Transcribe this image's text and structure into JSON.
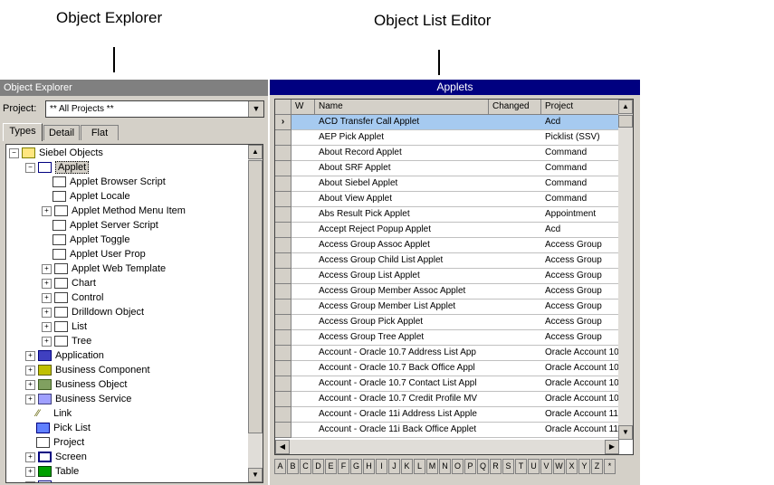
{
  "callouts": {
    "explorer": "Object Explorer",
    "list_editor": "Object List Editor"
  },
  "explorer": {
    "title": "Object Explorer",
    "project_label": "Project:",
    "project_value": "** All Projects **",
    "tabs": [
      "Types",
      "Detail",
      "Flat"
    ],
    "tree": [
      {
        "label": "Siebel Objects",
        "icon": "siebel-objects-icon",
        "cls": "folder-y",
        "indent": 0,
        "exp": "−"
      },
      {
        "label": "Applet",
        "icon": "applet-folder-icon",
        "cls": "folder-b",
        "indent": 1,
        "exp": "−",
        "selected": true
      },
      {
        "label": "Applet Browser Script",
        "icon": "folder-icon",
        "cls": "folder-w",
        "indent": 2,
        "exp": ""
      },
      {
        "label": "Applet Locale",
        "icon": "folder-icon",
        "cls": "folder-w",
        "indent": 2,
        "exp": ""
      },
      {
        "label": "Applet Method Menu Item",
        "icon": "folder-icon",
        "cls": "folder-w",
        "indent": 2,
        "exp": "+"
      },
      {
        "label": "Applet Server Script",
        "icon": "folder-icon",
        "cls": "folder-w",
        "indent": 2,
        "exp": ""
      },
      {
        "label": "Applet Toggle",
        "icon": "folder-icon",
        "cls": "folder-w",
        "indent": 2,
        "exp": ""
      },
      {
        "label": "Applet User Prop",
        "icon": "folder-icon",
        "cls": "folder-w",
        "indent": 2,
        "exp": ""
      },
      {
        "label": "Applet Web Template",
        "icon": "folder-icon",
        "cls": "folder-w",
        "indent": 2,
        "exp": "+"
      },
      {
        "label": "Chart",
        "icon": "folder-icon",
        "cls": "folder-w",
        "indent": 2,
        "exp": "+"
      },
      {
        "label": "Control",
        "icon": "folder-icon",
        "cls": "folder-w",
        "indent": 2,
        "exp": "+"
      },
      {
        "label": "Drilldown Object",
        "icon": "folder-icon",
        "cls": "folder-w",
        "indent": 2,
        "exp": "+"
      },
      {
        "label": "List",
        "icon": "folder-icon",
        "cls": "folder-w",
        "indent": 2,
        "exp": "+"
      },
      {
        "label": "Tree",
        "icon": "folder-icon",
        "cls": "folder-w",
        "indent": 2,
        "exp": "+"
      },
      {
        "label": "Application",
        "icon": "application-icon",
        "cls": "app",
        "indent": 1,
        "exp": "+"
      },
      {
        "label": "Business Component",
        "icon": "business-component-icon",
        "cls": "bc",
        "indent": 1,
        "exp": "+"
      },
      {
        "label": "Business Object",
        "icon": "business-object-icon",
        "cls": "bo",
        "indent": 1,
        "exp": "+"
      },
      {
        "label": "Business Service",
        "icon": "business-service-icon",
        "cls": "bs",
        "indent": 1,
        "exp": "+"
      },
      {
        "label": "Link",
        "icon": "link-icon",
        "cls": "link",
        "indent": 1,
        "exp": ""
      },
      {
        "label": "Pick List",
        "icon": "pick-list-icon",
        "cls": "pick",
        "indent": 1,
        "exp": ""
      },
      {
        "label": "Project",
        "icon": "project-icon",
        "cls": "proj",
        "indent": 1,
        "exp": ""
      },
      {
        "label": "Screen",
        "icon": "screen-icon",
        "cls": "screen",
        "indent": 1,
        "exp": "+"
      },
      {
        "label": "Table",
        "icon": "table-icon",
        "cls": "table",
        "indent": 1,
        "exp": "+"
      },
      {
        "label": "",
        "icon": "folder-icon",
        "cls": "folder-b",
        "indent": 1,
        "exp": "+"
      }
    ]
  },
  "list_editor": {
    "title": "Applets",
    "columns": [
      "W",
      "Name",
      "Changed",
      "Project"
    ],
    "current_marker": "›",
    "rows": [
      {
        "name": "ACD Transfer Call Applet",
        "changed": "",
        "project": "Acd"
      },
      {
        "name": "AEP Pick Applet",
        "changed": "",
        "project": "Picklist (SSV)"
      },
      {
        "name": "About Record Applet",
        "changed": "",
        "project": "Command"
      },
      {
        "name": "About SRF Applet",
        "changed": "",
        "project": "Command"
      },
      {
        "name": "About Siebel Applet",
        "changed": "",
        "project": "Command"
      },
      {
        "name": "About View Applet",
        "changed": "",
        "project": "Command"
      },
      {
        "name": "Abs Result Pick Applet",
        "changed": "",
        "project": "Appointment"
      },
      {
        "name": "Accept Reject Popup Applet",
        "changed": "",
        "project": "Acd"
      },
      {
        "name": "Access Group Assoc Applet",
        "changed": "",
        "project": "Access Group"
      },
      {
        "name": "Access Group Child List Applet",
        "changed": "",
        "project": "Access Group"
      },
      {
        "name": "Access Group List Applet",
        "changed": "",
        "project": "Access Group"
      },
      {
        "name": "Access Group Member Assoc Applet",
        "changed": "",
        "project": "Access Group"
      },
      {
        "name": "Access Group Member List Applet",
        "changed": "",
        "project": "Access Group"
      },
      {
        "name": "Access Group Pick Applet",
        "changed": "",
        "project": "Access Group"
      },
      {
        "name": "Access Group Tree Applet",
        "changed": "",
        "project": "Access Group"
      },
      {
        "name": "Account - Oracle 10.7 Address List App",
        "changed": "",
        "project": "Oracle Account 10"
      },
      {
        "name": "Account - Oracle 10.7 Back Office Appl",
        "changed": "",
        "project": "Oracle Account 10"
      },
      {
        "name": "Account - Oracle 10.7 Contact List Appl",
        "changed": "",
        "project": "Oracle Account 10"
      },
      {
        "name": "Account - Oracle 10.7 Credit Profile MV",
        "changed": "",
        "project": "Oracle Account 10"
      },
      {
        "name": "Account - Oracle 11i Address List Apple",
        "changed": "",
        "project": "Oracle Account 11"
      },
      {
        "name": "Account - Oracle 11i Back Office Applet",
        "changed": "",
        "project": "Oracle Account 11"
      }
    ],
    "alphabet": [
      "A",
      "B",
      "C",
      "D",
      "E",
      "F",
      "G",
      "H",
      "I",
      "J",
      "K",
      "L",
      "M",
      "N",
      "O",
      "P",
      "Q",
      "R",
      "S",
      "T",
      "U",
      "V",
      "W",
      "X",
      "Y",
      "Z",
      "*"
    ]
  }
}
